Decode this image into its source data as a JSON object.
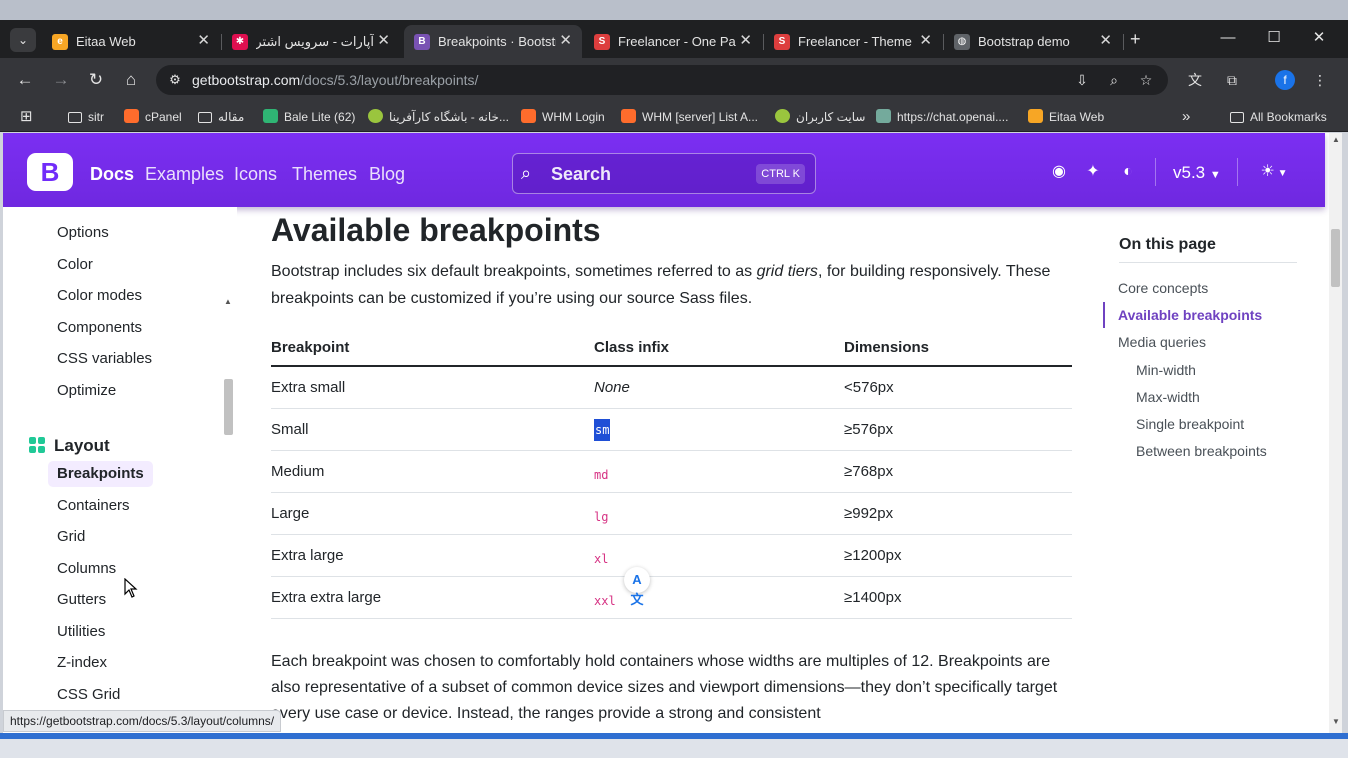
{
  "browser": {
    "tabs": [
      {
        "title": "Eitaa Web",
        "favicon": "eitaa-icon",
        "color": "#f7a625",
        "glyph": "e"
      },
      {
        "title": "آپارات - سرویس اشتراک",
        "favicon": "aparat-icon",
        "color": "#df0f50",
        "glyph": "✱"
      },
      {
        "title": "Breakpoints · Bootstrap",
        "favicon": "bootstrap-icon",
        "color": "#7952b3",
        "glyph": "B",
        "active": true
      },
      {
        "title": "Freelancer - One Page",
        "favicon": "startbootstrap-icon",
        "color": "#dd3e3e",
        "glyph": "S"
      },
      {
        "title": "Freelancer - Theme Pre",
        "favicon": "startbootstrap-icon",
        "color": "#dd3e3e",
        "glyph": "S"
      },
      {
        "title": "Bootstrap demo",
        "favicon": "globe-icon",
        "color": "#5f6368",
        "glyph": "◍"
      }
    ],
    "address": {
      "host": "getbootstrap.com",
      "path": "/docs/5.3/layout/breakpoints/"
    },
    "bookmarks": [
      {
        "label": "sitr",
        "icon": "folder-icon"
      },
      {
        "label": "cPanel",
        "icon": "cpanel-icon"
      },
      {
        "label": "مقاله",
        "icon": "folder-icon"
      },
      {
        "label": "Bale Lite (62)",
        "icon": "bale-icon"
      },
      {
        "label": "خانه - باشگاه کارآفرینا...",
        "icon": "site-icon"
      },
      {
        "label": "WHM Login",
        "icon": "cpanel-icon"
      },
      {
        "label": "WHM [server] List A...",
        "icon": "cpanel-icon"
      },
      {
        "label": "سایت کاربران",
        "icon": "site-icon"
      },
      {
        "label": "https://chat.openai....",
        "icon": "openai-icon"
      },
      {
        "label": "Eitaa Web",
        "icon": "eitaa-icon"
      }
    ],
    "all_bookmarks": "All Bookmarks",
    "profile_initial": "f",
    "status_url": "https://getbootstrap.com/docs/5.3/layout/columns/"
  },
  "site": {
    "brand": "B",
    "nav": [
      "Docs",
      "Examples",
      "Icons",
      "Themes",
      "Blog"
    ],
    "search_label": "Search",
    "search_kbd": "CTRL K",
    "version": "v5.3",
    "accent": "#712cf9"
  },
  "sidebar": {
    "items_top": [
      "Options",
      "Color",
      "Color modes",
      "Components",
      "CSS variables",
      "Optimize"
    ],
    "section": "Layout",
    "items_layout": [
      "Breakpoints",
      "Containers",
      "Grid",
      "Columns",
      "Gutters",
      "Utilities",
      "Z-index",
      "CSS Grid"
    ],
    "active": "Breakpoints"
  },
  "content": {
    "title": "Available breakpoints",
    "lead_pre": "Bootstrap includes six default breakpoints, sometimes referred to as ",
    "lead_em": "grid tiers",
    "lead_post": ", for building responsively. These breakpoints can be customized if you’re using our source Sass files.",
    "table": {
      "headers": [
        "Breakpoint",
        "Class infix",
        "Dimensions"
      ],
      "rows": [
        {
          "breakpoint": "Extra small",
          "infix": "None",
          "dimension": "<576px"
        },
        {
          "breakpoint": "Small",
          "infix": "sm",
          "dimension": "≥576px"
        },
        {
          "breakpoint": "Medium",
          "infix": "md",
          "dimension": "≥768px"
        },
        {
          "breakpoint": "Large",
          "infix": "lg",
          "dimension": "≥992px"
        },
        {
          "breakpoint": "Extra large",
          "infix": "xl",
          "dimension": "≥1200px"
        },
        {
          "breakpoint": "Extra extra large",
          "infix": "xxl",
          "dimension": "≥1400px"
        }
      ]
    },
    "para2": "Each breakpoint was chosen to comfortably hold containers whose widths are multiples of 12. Breakpoints are also representative of a subset of common device sizes and viewport dimensions—they don’t specifically target every use case or device. Instead, the ranges provide a strong and consistent"
  },
  "toc": {
    "heading": "On this page",
    "links": [
      {
        "label": "Core concepts",
        "level": 1
      },
      {
        "label": "Available breakpoints",
        "level": 1,
        "active": true
      },
      {
        "label": "Media queries",
        "level": 1
      },
      {
        "label": "Min-width",
        "level": 2
      },
      {
        "label": "Max-width",
        "level": 2
      },
      {
        "label": "Single breakpoint",
        "level": 2
      },
      {
        "label": "Between breakpoints",
        "level": 2
      }
    ]
  }
}
